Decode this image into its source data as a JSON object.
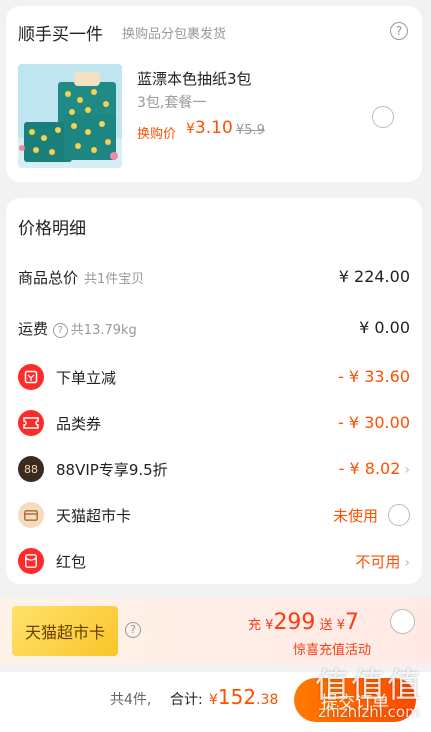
{
  "addon": {
    "title": "顺手买一件",
    "subtitle": "换购品分包裹发货",
    "help_glyph": "?",
    "product": {
      "name": "蓝漂本色抽纸3包",
      "spec": "3包,套餐一",
      "price_label": "换购价",
      "currency": "¥",
      "price": "3.10",
      "original_price": "¥5.9"
    }
  },
  "detail": {
    "title": "价格明细",
    "goods_total": {
      "label": "商品总价",
      "sub": "共1件宝贝",
      "value": "¥ 224.00"
    },
    "shipping": {
      "label": "运费",
      "sub": "共13.79kg",
      "value": "¥ 0.00"
    },
    "order_discount": {
      "label": "下单立减",
      "value": "- ¥ 33.60"
    },
    "category_coupon": {
      "label": "品类券",
      "value": "- ¥ 30.00"
    },
    "vip": {
      "label": "88VIP专享9.5折",
      "icon_text": "88",
      "value": "- ¥ 8.02"
    },
    "market_card": {
      "label": "天猫超市卡",
      "value": "未使用"
    },
    "red_packet": {
      "label": "红包",
      "value": "不可用"
    }
  },
  "card_banner": {
    "badge": "天猫超市卡",
    "charge_prefix": "充",
    "charge_currency": "¥",
    "charge_amount": "299",
    "gift_prefix": "送",
    "gift_currency": "¥",
    "gift_amount": "7",
    "promo": "惊喜充值活动"
  },
  "bottom": {
    "count": "共4件,",
    "total_label": "合计:",
    "currency": "¥",
    "total_int": "152",
    "total_dec": ".38",
    "submit": "提交订单"
  },
  "watermark": {
    "big": "值值值",
    "small": "zhizhizhi.com"
  },
  "colors": {
    "accent": "#ff5000",
    "vip_dark": "#3a2a1f",
    "card_gold": "#f9c52a"
  }
}
